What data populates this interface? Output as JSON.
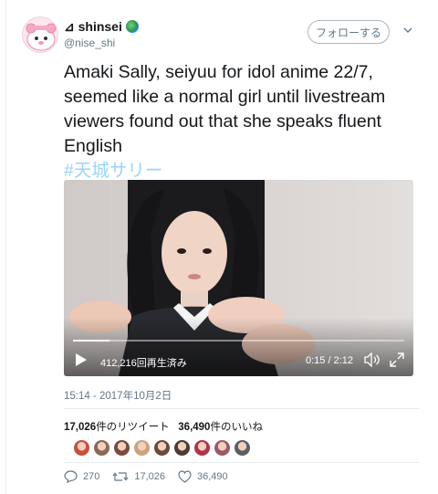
{
  "user": {
    "display_name": "⊿ shinsei",
    "handle": "@nise_shi",
    "follow_label": "フォローする"
  },
  "tweet": {
    "text": "Amaki Sally, seiyuu for idol anime 22/7, seemed like a normal girl until livestream viewers found out that she speaks fluent English",
    "hashtag": "#天城サリー"
  },
  "video": {
    "views": "412,216回再生済み",
    "time": "0:15 / 2:12",
    "progress": 0.11
  },
  "timestamp": "15:14 - 2017年10月2日",
  "stats": {
    "retweets_count": "17,026",
    "retweets_label": "件のリツイート",
    "likes_count": "36,490",
    "likes_label": "件のいいね"
  },
  "liker_colors": [
    "#c84f3c",
    "#8a6a55",
    "#7a4a3a",
    "#c9a27e",
    "#6a4b3b",
    "#4a3b35",
    "#b2334c",
    "#9a5a6a",
    "#5a5f66"
  ],
  "actions": {
    "replies": "270",
    "retweets": "17,026",
    "likes": "36,490"
  },
  "colors": {
    "accent": "#1da1f2",
    "muted": "#657786"
  }
}
